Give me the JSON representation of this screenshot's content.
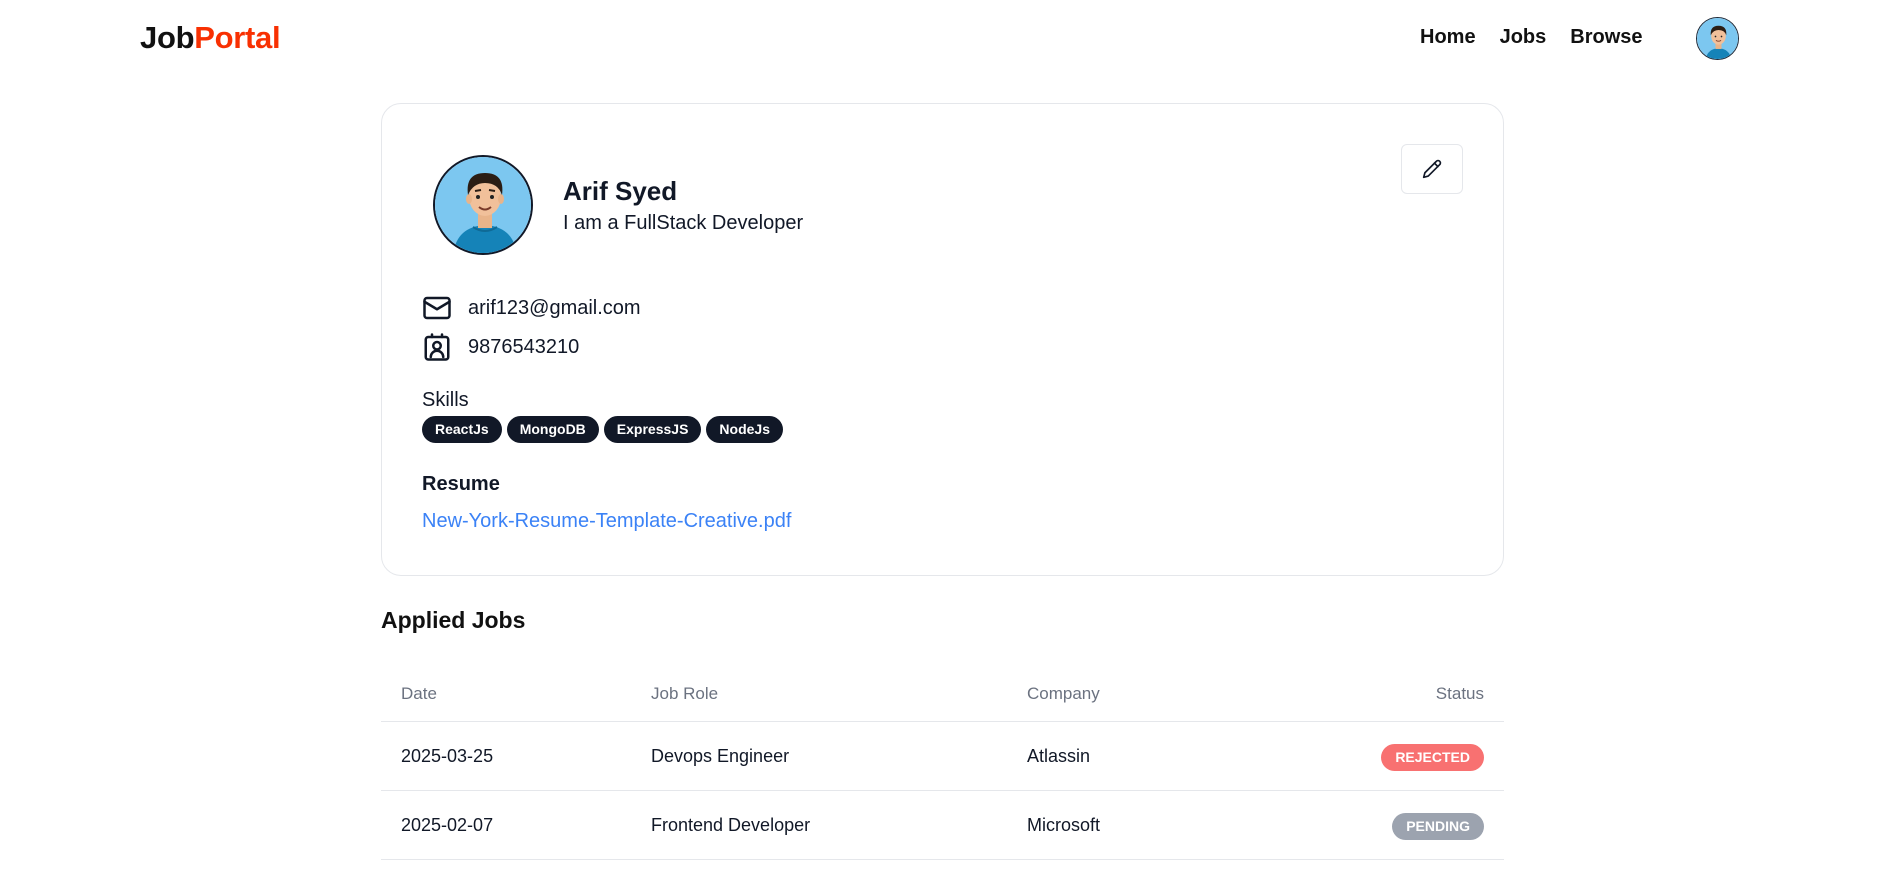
{
  "header": {
    "logo_part1": "Job",
    "logo_part2": "Portal",
    "nav": [
      {
        "label": "Home"
      },
      {
        "label": "Jobs"
      },
      {
        "label": "Browse"
      }
    ],
    "avatar_icon": "user-avatar-icon"
  },
  "profile": {
    "name": "Arif Syed",
    "bio": "I am a FullStack Developer",
    "email": "arif123@gmail.com",
    "phone": "9876543210",
    "skills_label": "Skills",
    "skills": [
      "ReactJs",
      "MongoDB",
      "ExpressJS",
      "NodeJs"
    ],
    "resume_label": "Resume",
    "resume_file": "New-York-Resume-Template-Creative.pdf",
    "edit_icon": "pencil-icon"
  },
  "applied_jobs": {
    "title": "Applied Jobs",
    "columns": {
      "date": "Date",
      "role": "Job Role",
      "company": "Company",
      "status": "Status"
    },
    "rows": [
      {
        "date": "2025-03-25",
        "role": "Devops Engineer",
        "company": "Atlassin",
        "status": "REJECTED"
      },
      {
        "date": "2025-02-07",
        "role": "Frontend Developer",
        "company": "Microsoft",
        "status": "PENDING"
      }
    ]
  },
  "colors": {
    "accent": "#f83002",
    "link": "#3b82f6",
    "rejected": "#f87171",
    "pending": "#9ca3af",
    "badge_dark": "#111827"
  }
}
